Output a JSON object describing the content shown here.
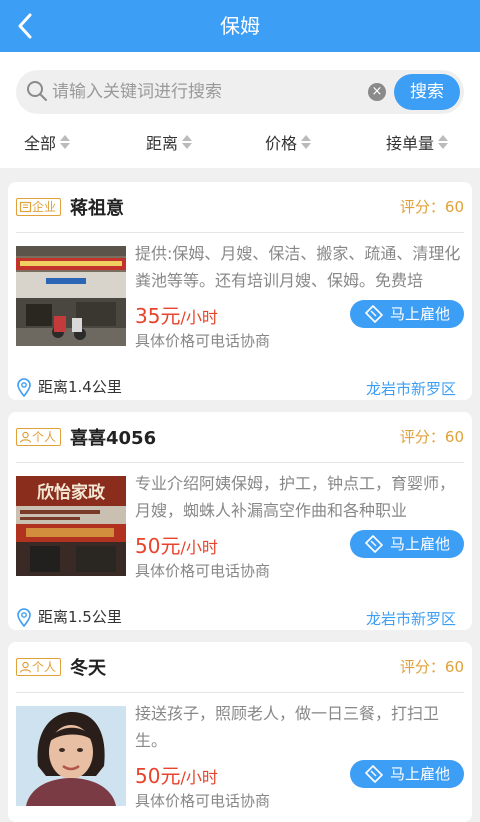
{
  "header": {
    "title": "保姆"
  },
  "search": {
    "placeholder": "请输入关键词进行搜索",
    "button": "搜索",
    "clear": "×"
  },
  "filters": [
    {
      "label": "全部"
    },
    {
      "label": "距离"
    },
    {
      "label": "价格"
    },
    {
      "label": "接单量"
    }
  ],
  "colors": {
    "primary": "#3d9ef5",
    "price": "#e8432c",
    "tag": "#e0a13a"
  },
  "cards": [
    {
      "tag": "企业",
      "tag_icon": "company-icon",
      "name": "蒋祖意",
      "score": "评分：60",
      "desc": "提供:保姆、月嫂、保洁、搬家、疏通、清理化粪池等等。还有培训月嫂、保姆。免费培",
      "price": "35元",
      "unit": "/小时",
      "note": "具体价格可电话协商",
      "hire": "马上雇他",
      "distance": "距离1.4公里",
      "area": "龙岩市新罗区"
    },
    {
      "tag": "个人",
      "tag_icon": "person-icon",
      "name": "喜喜4056",
      "score": "评分：60",
      "desc": "专业介绍阿姨保姆，护工，钟点工，育婴师，月嫂，蜘蛛人补漏高空作曲和各种职业",
      "price": "50元",
      "unit": "/小时",
      "note": "具体价格可电话协商",
      "hire": "马上雇他",
      "distance": "距离1.5公里",
      "area": "龙岩市新罗区",
      "photo_sign": "欣怡家政"
    },
    {
      "tag": "个人",
      "tag_icon": "person-icon",
      "name": "冬天",
      "score": "评分：60",
      "desc": "接送孩子，照顾老人，做一日三餐，打扫卫生。",
      "price": "50元",
      "unit": "/小时",
      "note": "具体价格可电话协商",
      "hire": "马上雇他"
    }
  ]
}
